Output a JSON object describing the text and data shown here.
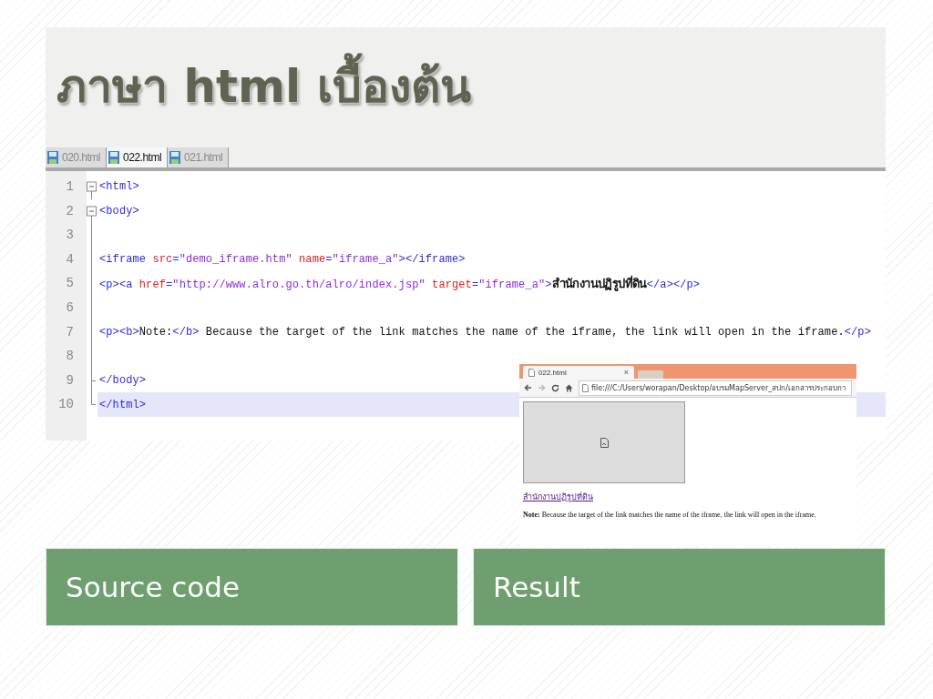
{
  "title": "ภาษา html เบื้องต้น",
  "editor": {
    "tabs": [
      {
        "label": "020.html",
        "selected": false
      },
      {
        "label": "022.html",
        "selected": true
      },
      {
        "label": "021.html",
        "selected": false
      }
    ],
    "lines": [
      {
        "number": "1",
        "highlighted": false,
        "tokens": [
          {
            "kind": "tag",
            "text": "<html>"
          }
        ]
      },
      {
        "number": "2",
        "highlighted": false,
        "tokens": [
          {
            "kind": "tag",
            "text": "<body>"
          }
        ]
      },
      {
        "number": "3",
        "highlighted": false
      },
      {
        "number": "4",
        "highlighted": false,
        "tokens": [
          {
            "kind": "tag",
            "text": "<iframe "
          },
          {
            "kind": "attr",
            "text": "src"
          },
          {
            "kind": "tag",
            "text": "="
          },
          {
            "kind": "value",
            "text": "\"demo_iframe.htm\" "
          },
          {
            "kind": "attr",
            "text": "name"
          },
          {
            "kind": "tag",
            "text": "="
          },
          {
            "kind": "value",
            "text": "\"iframe_a\""
          },
          {
            "kind": "tag",
            "text": "></iframe>"
          }
        ]
      },
      {
        "number": "5",
        "highlighted": false,
        "tokens": [
          {
            "kind": "tag",
            "text": "<p><a "
          },
          {
            "kind": "attr",
            "text": "href"
          },
          {
            "kind": "tag",
            "text": "="
          },
          {
            "kind": "value",
            "text": "\"http://www.alro.go.th/alro/index.jsp\" "
          },
          {
            "kind": "attr",
            "text": "target"
          },
          {
            "kind": "tag",
            "text": "="
          },
          {
            "kind": "value",
            "text": "\"iframe_a\""
          },
          {
            "kind": "tag",
            "text": ">"
          },
          {
            "kind": "bold",
            "text": "สำนักงานปฏิรูปที่ดิน"
          },
          {
            "kind": "tag",
            "text": "</a></p>"
          }
        ]
      },
      {
        "number": "6",
        "highlighted": false
      },
      {
        "number": "7",
        "highlighted": false,
        "tokens": [
          {
            "kind": "tag",
            "text": "<p><b>"
          },
          {
            "kind": "text",
            "text": "Note:"
          },
          {
            "kind": "tag",
            "text": "</b>"
          },
          {
            "kind": "text",
            "text": " Because the target of the link matches the name of the iframe, the link will open in the iframe."
          },
          {
            "kind": "tag",
            "text": "</p>"
          }
        ]
      },
      {
        "number": "8",
        "highlighted": false
      },
      {
        "number": "9",
        "highlighted": false,
        "tokens": [
          {
            "kind": "tag",
            "text": "</body>"
          }
        ]
      },
      {
        "number": "10",
        "highlighted": true,
        "tokens": [
          {
            "kind": "tag",
            "text": "</html>"
          }
        ]
      }
    ]
  },
  "browser": {
    "tab_title": "022.html",
    "tab_close": "×",
    "url": "file:///C:/Users/worapan/Desktop/อบรมMapServer_สปก/เอกสารประกอบกา",
    "link": "สำนักงานปฏิรูปที่ดิน",
    "note": "**Note:** Because the target of the link matches the name of the iframe, the link will open in the iframe."
  },
  "captions": [
    "Source code",
    "Result"
  ]
}
